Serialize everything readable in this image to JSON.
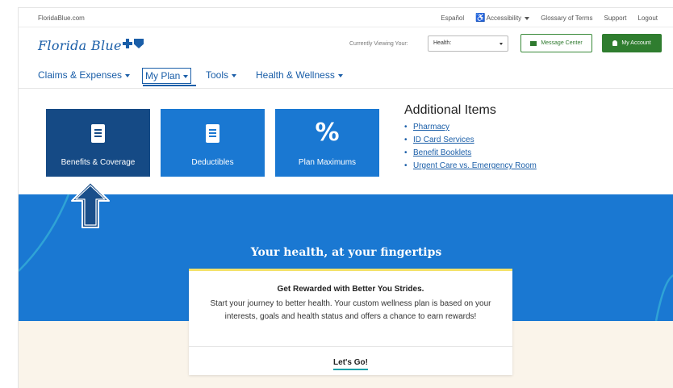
{
  "utility_bar": {
    "site": "FloridaBlue.com",
    "links": [
      "Español",
      "Accessibility",
      "Glossary of Terms",
      "Support",
      "Logout"
    ]
  },
  "header": {
    "logo": "Florida Blue",
    "viewing_label": "Currently Viewing Your:",
    "viewing_value": "Health:",
    "message_center": "Message Center",
    "my_account": "My Account"
  },
  "nav": {
    "items": [
      "Claims & Expenses",
      "My Plan",
      "Tools",
      "Health & Wellness"
    ],
    "active": "My Plan"
  },
  "tiles": [
    {
      "label": "Benefits & Coverage",
      "icon": "document-icon"
    },
    {
      "label": "Deductibles",
      "icon": "document-icon"
    },
    {
      "label": "Plan Maximums",
      "icon": "percent-icon",
      "glyph": "%"
    }
  ],
  "additional": {
    "title": "Additional Items",
    "items": [
      "Pharmacy",
      "ID Card Services",
      "Benefit Booklets",
      "Urgent Care vs. Emergency Room"
    ]
  },
  "hero": {
    "headline": "Your health, at your fingertips"
  },
  "card": {
    "title": "Get Rewarded with Better You Strides.",
    "body": "Start your journey to better health. Your custom wellness plan is based on your interests, goals and health status and offers a chance to earn rewards!",
    "cta": "Let's Go!"
  },
  "colors": {
    "brand_blue": "#1a78d2",
    "dark_blue": "#154a85",
    "green": "#2f7d2f"
  }
}
